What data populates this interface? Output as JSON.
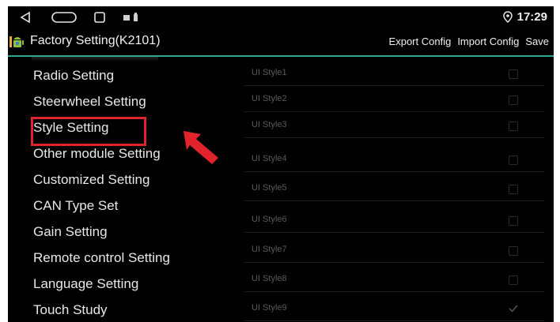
{
  "statusbar": {
    "time": "17:29",
    "icons": [
      "back-icon",
      "home-icon",
      "recents-icon",
      "notification-icons",
      "location-icon"
    ]
  },
  "titlebar": {
    "title": "Factory Setting(K2101)",
    "export_label": "Export Config",
    "import_label": "Import Config",
    "save_label": "Save"
  },
  "menu": {
    "items": [
      "Radio Setting",
      "Steerwheel Setting",
      "Style Setting",
      "Other module Setting",
      "Customized Setting",
      "CAN Type Set",
      "Gain Setting",
      "Remote control Setting",
      "Language Setting",
      "Touch Study"
    ],
    "highlighted": "Style Setting"
  },
  "styles": {
    "items": [
      {
        "label": "UI Style1",
        "checked": false
      },
      {
        "label": "UI Style2",
        "checked": false
      },
      {
        "label": "UI Style3",
        "checked": false
      },
      {
        "label": "UI Style4",
        "checked": false
      },
      {
        "label": "UI Style5",
        "checked": false
      },
      {
        "label": "UI Style6",
        "checked": false
      },
      {
        "label": "UI Style7",
        "checked": false
      },
      {
        "label": "UI Style8",
        "checked": false
      },
      {
        "label": "UI Style9",
        "checked": true
      }
    ]
  },
  "colors": {
    "accent": "#2aa58e",
    "annotation": "#e1232b",
    "background": "#000000"
  }
}
